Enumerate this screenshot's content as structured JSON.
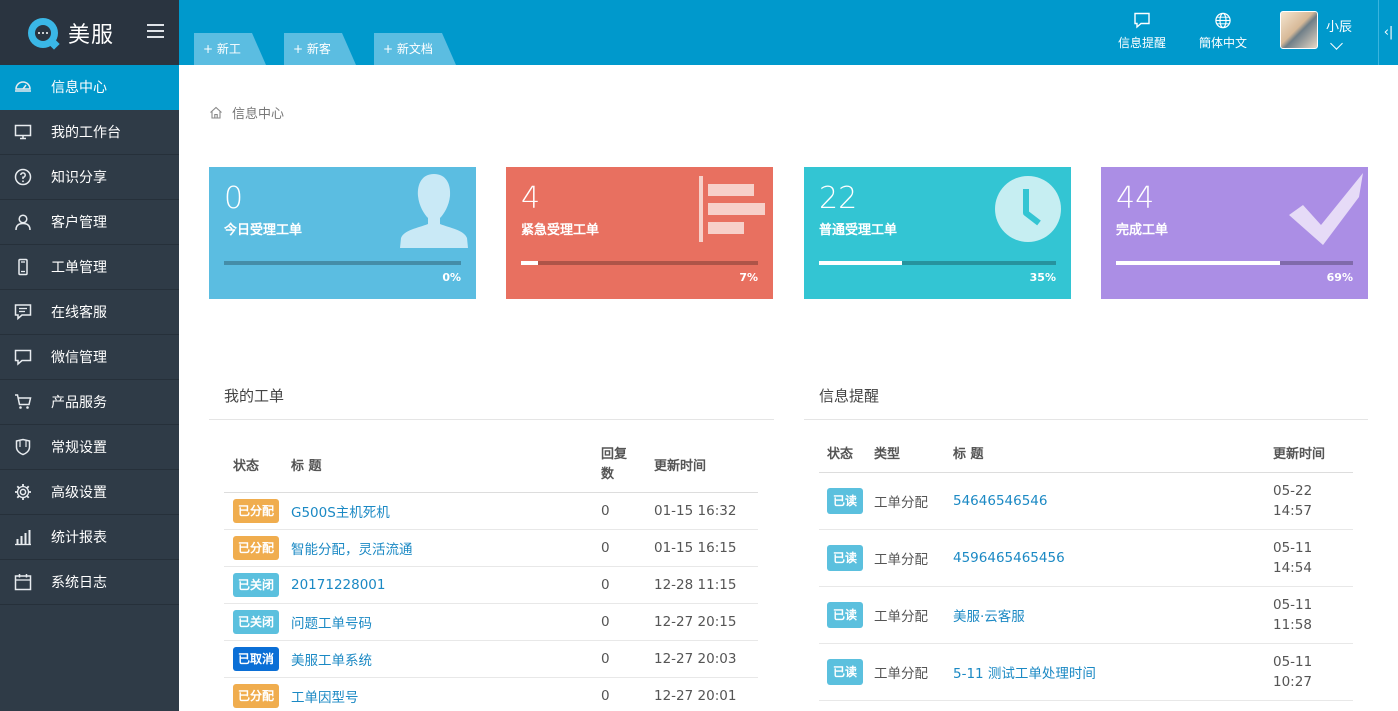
{
  "brand": {
    "name": "美服"
  },
  "sidebar": {
    "items": [
      {
        "label": "信息中心",
        "icon": "cloud-dashboard-icon",
        "active": true
      },
      {
        "label": "我的工作台",
        "icon": "monitor-icon"
      },
      {
        "label": "知识分享",
        "icon": "question-circle-icon"
      },
      {
        "label": "客户管理",
        "icon": "user-icon"
      },
      {
        "label": "工单管理",
        "icon": "phone-icon"
      },
      {
        "label": "在线客服",
        "icon": "chat-lines-icon"
      },
      {
        "label": "微信管理",
        "icon": "chat-bubble-icon"
      },
      {
        "label": "产品服务",
        "icon": "cart-icon"
      },
      {
        "label": "常规设置",
        "icon": "shield-icon"
      },
      {
        "label": "高级设置",
        "icon": "gear-icon"
      },
      {
        "label": "统计报表",
        "icon": "bar-chart-icon"
      },
      {
        "label": "系统日志",
        "icon": "calendar-icon"
      }
    ]
  },
  "topbar": {
    "quick_tabs": [
      "+ 新工单",
      "+ 新客户",
      "+ 新文档"
    ],
    "notify_label": "信息提醒",
    "lang_label": "簡体中文",
    "user_name": "小辰",
    "collapse_label": "‹|"
  },
  "breadcrumb": {
    "current": "信息中心"
  },
  "stats": [
    {
      "value": "0",
      "label": "今日受理工单",
      "percent": 0,
      "percent_label": "0%",
      "color": "#5bbde1",
      "icon": "person-silhouette-icon"
    },
    {
      "value": "4",
      "label": "紧急受理工单",
      "percent": 7,
      "percent_label": "7%",
      "color": "#e87060",
      "icon": "list-bars-icon"
    },
    {
      "value": "22",
      "label": "普通受理工单",
      "percent": 35,
      "percent_label": "35%",
      "color": "#33c5d3",
      "icon": "clock-icon"
    },
    {
      "value": "44",
      "label": "完成工单",
      "percent": 69,
      "percent_label": "69%",
      "color": "#ab8ee5",
      "icon": "checkmark-icon"
    }
  ],
  "my_tickets": {
    "title": "我的工单",
    "headers": {
      "status": "状态",
      "subject": "标 题",
      "replies": "回复数",
      "updated": "更新时间"
    },
    "rows": [
      {
        "status": "已分配",
        "status_color": "#f0ad4e",
        "subject": "G500S主机死机",
        "replies": "0",
        "updated": "01-15 16:32"
      },
      {
        "status": "已分配",
        "status_color": "#f0ad4e",
        "subject": "智能分配，灵活流通",
        "replies": "0",
        "updated": "01-15 16:15"
      },
      {
        "status": "已关闭",
        "status_color": "#5bc0de",
        "subject": "20171228001",
        "replies": "0",
        "updated": "12-28 11:15"
      },
      {
        "status": "已关闭",
        "status_color": "#5bc0de",
        "subject": "问题工单号码",
        "replies": "0",
        "updated": "12-27 20:15"
      },
      {
        "status": "已取消",
        "status_color": "#0b6fd6",
        "subject": "美服工单系统",
        "replies": "0",
        "updated": "12-27 20:03"
      },
      {
        "status": "已分配",
        "status_color": "#f0ad4e",
        "subject": "工单因型号",
        "replies": "0",
        "updated": "12-27 20:01"
      }
    ]
  },
  "reminders": {
    "title": "信息提醒",
    "headers": {
      "status": "状态",
      "type": "类型",
      "subject": "标 题",
      "updated": "更新时间"
    },
    "rows": [
      {
        "status": "已读",
        "type": "工单分配",
        "subject": "54646546546",
        "updated_date": "05-22",
        "updated_time": "14:57"
      },
      {
        "status": "已读",
        "type": "工单分配",
        "subject": "4596465465456",
        "updated_date": "05-11",
        "updated_time": "14:54"
      },
      {
        "status": "已读",
        "type": "工单分配",
        "subject": "美服·云客服",
        "updated_date": "05-11",
        "updated_time": "11:58"
      },
      {
        "status": "已读",
        "type": "工单分配",
        "subject": "5-11 测试工单处理时间",
        "updated_date": "05-11",
        "updated_time": "10:27"
      }
    ]
  }
}
